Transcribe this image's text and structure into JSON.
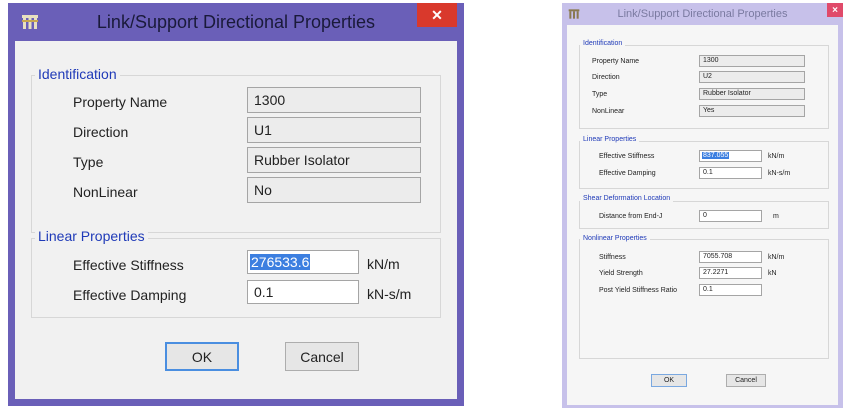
{
  "left_dialog": {
    "title": "Link/Support Directional Properties",
    "close_glyph": "✕",
    "identification": {
      "legend": "Identification",
      "property_name_label": "Property Name",
      "property_name_value": "1300",
      "direction_label": "Direction",
      "direction_value": "U1",
      "type_label": "Type",
      "type_value": "Rubber Isolator",
      "nonlinear_label": "NonLinear",
      "nonlinear_value": "No"
    },
    "linear": {
      "legend": "Linear Properties",
      "stiffness_label": "Effective Stiffness",
      "stiffness_value": "276533.6",
      "stiffness_unit": "kN/m",
      "damping_label": "Effective Damping",
      "damping_value": "0.1",
      "damping_unit": "kN-s/m"
    },
    "ok_label": "OK",
    "cancel_label": "Cancel"
  },
  "right_dialog": {
    "title": "Link/Support Directional Properties",
    "close_glyph": "×",
    "identification": {
      "legend": "Identification",
      "property_name_label": "Property Name",
      "property_name_value": "1300",
      "direction_label": "Direction",
      "direction_value": "U2",
      "type_label": "Type",
      "type_value": "Rubber Isolator",
      "nonlinear_label": "NonLinear",
      "nonlinear_value": "Yes"
    },
    "linear": {
      "legend": "Linear Properties",
      "stiffness_label": "Effective Stiffness",
      "stiffness_value": "837.055",
      "stiffness_unit": "kN/m",
      "damping_label": "Effective Damping",
      "damping_value": "0.1",
      "damping_unit": "kN-s/m"
    },
    "shear": {
      "legend": "Shear Deformation Location",
      "distance_label": "Distance from End-J",
      "distance_value": "0",
      "distance_unit": "m"
    },
    "nonlinear": {
      "legend": "Nonlinear Properties",
      "stiffness_label": "Stiffness",
      "stiffness_value": "7055.708",
      "stiffness_unit": "kN/m",
      "yield_label": "Yield Strength",
      "yield_value": "27.2271",
      "yield_unit": "kN",
      "ratio_label": "Post Yield Stiffness Ratio",
      "ratio_value": "0.1"
    },
    "ok_label": "OK",
    "cancel_label": "Cancel"
  }
}
